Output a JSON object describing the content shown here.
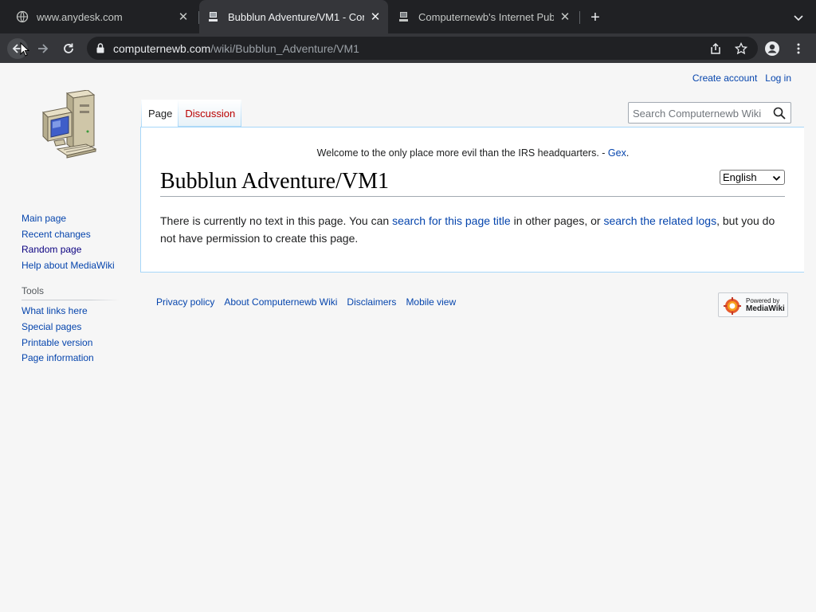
{
  "browser": {
    "tabs": [
      {
        "title": "www.anydesk.com",
        "favicon": "globe-icon"
      },
      {
        "title": "Bubblun Adventure/VM1 - Com",
        "favicon": "computer-icon"
      },
      {
        "title": "Computernewb's Internet Pub",
        "favicon": "computer-icon"
      }
    ],
    "url_host": "computernewb.com",
    "url_path": "/wiki/Bubblun_Adventure/VM1"
  },
  "personal": {
    "create_account": "Create account",
    "login": "Log in"
  },
  "sidebar": {
    "nav": [
      "Main page",
      "Recent changes",
      "Random page",
      "Help about MediaWiki"
    ],
    "tools_heading": "Tools",
    "tools": [
      "What links here",
      "Special pages",
      "Printable version",
      "Page information"
    ]
  },
  "tabs": {
    "page": "Page",
    "discussion": "Discussion"
  },
  "search": {
    "placeholder": "Search Computernewb Wiki"
  },
  "sitenotice": {
    "text": "Welcome to the only place more evil than the IRS headquarters. - ",
    "link": "Gex",
    "end": "."
  },
  "language": {
    "selected": "English"
  },
  "article": {
    "title": "Bubblun Adventure/VM1",
    "text1": "There is currently no text in this page. You can ",
    "link1": "search for this page title",
    "text2": " in other pages, or ",
    "link2": "search the related logs",
    "text3": ", but you do not have permission to create this page."
  },
  "footer": {
    "links": [
      "Privacy policy",
      "About Computernewb Wiki",
      "Disclaimers",
      "Mobile view"
    ],
    "powered_small": "Powered by",
    "powered_big": "MediaWiki"
  }
}
